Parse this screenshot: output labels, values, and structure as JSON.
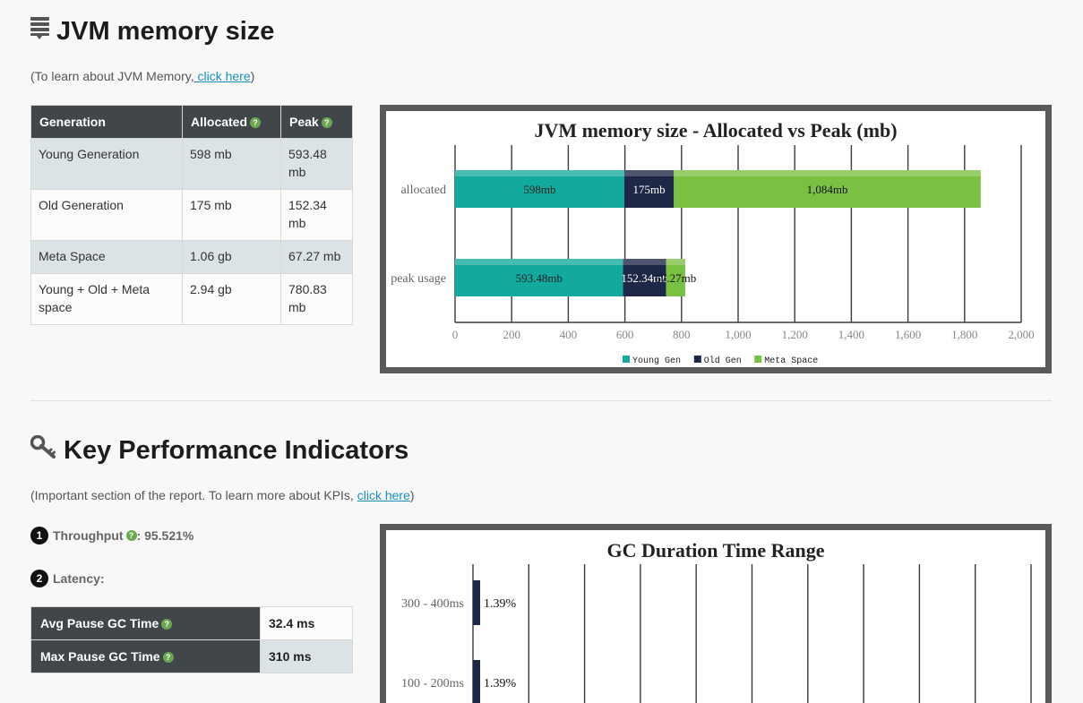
{
  "memory": {
    "title": "JVM memory size",
    "note_prefix": "(To learn about JVM Memory,",
    "note_link": " click here",
    "note_suffix": ")",
    "table": {
      "headers": [
        "Generation",
        "Allocated",
        "Peak"
      ],
      "rows": [
        [
          "Young Generation",
          "598 mb",
          "593.48 mb"
        ],
        [
          "Old Generation",
          "175 mb",
          "152.34 mb"
        ],
        [
          "Meta Space",
          "1.06 gb",
          "67.27 mb"
        ],
        [
          "Young + Old + Meta space",
          "2.94 gb",
          "780.83 mb"
        ]
      ]
    }
  },
  "kpi": {
    "title": "Key Performance Indicators",
    "note_prefix": "(Important section of the report. To learn more about KPIs, ",
    "note_link": "click here",
    "note_suffix": ")",
    "throughput_num": "1",
    "throughput_label": "Throughput",
    "throughput_value": " : 95.521%",
    "latency_num": "2",
    "latency_label": "Latency:",
    "pause_rows": [
      {
        "label": "Avg Pause GC Time",
        "value": "32.4 ms"
      },
      {
        "label": "Max Pause GC Time",
        "value": "310 ms"
      }
    ]
  },
  "help_glyph": "?",
  "chart_data": [
    {
      "type": "bar",
      "orientation": "horizontal",
      "stacked": true,
      "title": "JVM memory size - Allocated vs Peak (mb)",
      "categories": [
        "allocated",
        "peak usage"
      ],
      "series": [
        {
          "name": "Young Gen",
          "color": "#12a99e",
          "values": [
            598,
            593.48
          ],
          "labels": [
            "598mb",
            "593.48mb"
          ]
        },
        {
          "name": "Old Gen",
          "color": "#1d2747",
          "values": [
            175,
            152.34
          ],
          "labels": [
            "175mb",
            "152.34mb"
          ]
        },
        {
          "name": "Meta Space",
          "color": "#7ac142",
          "values": [
            1084,
            67.27
          ],
          "labels": [
            "1,084mb",
            "67.27mb"
          ]
        }
      ],
      "xlim": [
        0,
        2000
      ],
      "xticks": [
        "0",
        "200",
        "400",
        "600",
        "800",
        "1,000",
        "1,200",
        "1,400",
        "1,600",
        "1,800",
        "2,000"
      ],
      "grid": true,
      "legend": "bottom"
    },
    {
      "type": "bar",
      "orientation": "horizontal",
      "title": "GC Duration Time Range",
      "categories": [
        "300 - 400ms",
        "100 - 200ms"
      ],
      "values": [
        1.39,
        1.39
      ],
      "labels": [
        "1.39%",
        "1.39%"
      ],
      "color": "#1d2747",
      "grid": true
    }
  ]
}
